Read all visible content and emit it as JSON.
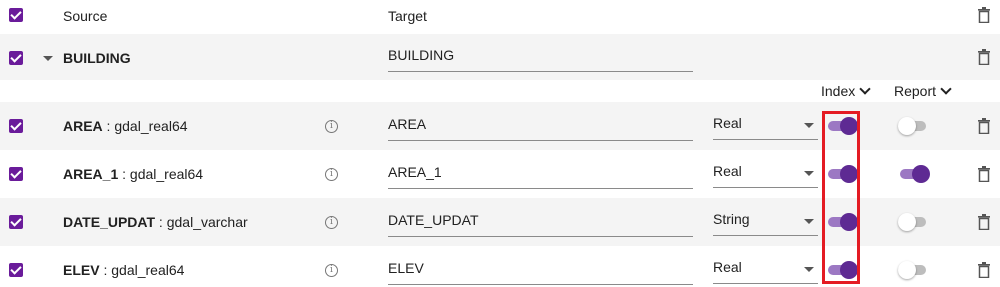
{
  "header": {
    "source_label": "Source",
    "target_label": "Target"
  },
  "group": {
    "name": "BUILDING",
    "target": "BUILDING"
  },
  "columns": {
    "index_label": "Index",
    "report_label": "Report"
  },
  "fields": [
    {
      "name": "AREA",
      "type": "gdal_real64",
      "target": "AREA",
      "data_type": "Real",
      "index": true,
      "report": false
    },
    {
      "name": "AREA_1",
      "type": "gdal_real64",
      "target": "AREA_1",
      "data_type": "Real",
      "index": true,
      "report": true
    },
    {
      "name": "DATE_UPDAT",
      "type": "gdal_varchar",
      "target": "DATE_UPDAT",
      "data_type": "String",
      "index": true,
      "report": false
    },
    {
      "name": "ELEV",
      "type": "gdal_real64",
      "target": "ELEV",
      "data_type": "Real",
      "index": true,
      "report": false
    }
  ],
  "separator": " : ",
  "colors": {
    "accent": "#6a1b9a",
    "toggle_on": "#5e2a93",
    "highlight": "#e41b23"
  }
}
